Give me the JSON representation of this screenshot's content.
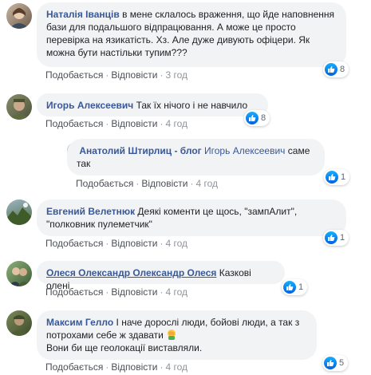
{
  "labels": {
    "like": "Подобається",
    "reply": "Відповісти",
    "dot": "·"
  },
  "comments": [
    {
      "author": "Наталія Іванців",
      "text": " в мене склалось враження, що йде наповнення бази для подальшого відпрацювання. А може це просто перевірка на язикатість. Хз. Але дуже дивують офіцери. Як можна бути настільки тупим???",
      "time": "3 год",
      "reactions": "8"
    },
    {
      "author": "Игорь Алексеевич",
      "text": " Так їх нічого і не навчило",
      "time": "4 год",
      "reactions": "8"
    },
    {
      "author": "Анатолий Штирлиц - блог",
      "text_prefix": " Игорь Алексеевич",
      "text": " саме так",
      "time": "4 год",
      "reactions": "1"
    },
    {
      "author": "Евгений Велетнюк",
      "text": " Деякі коменти це щось, \"зампАлит\", \"полковник пулеметчик\"",
      "time": "4 год",
      "reactions": "1"
    },
    {
      "author": "Олеся Олександр Олександр Олеся",
      "text": " Казкові олені",
      "time": "4 год",
      "reactions": "1"
    },
    {
      "author": "Максим Гелло",
      "text": " І наче дорослі люди, бойові люди, а так з потрохами себе ж здавати",
      "text2": "Вони би ще геолокації виставляли.",
      "time": "4 год",
      "reactions": "5"
    }
  ],
  "colors": {
    "author": "#385898",
    "bubble": "#f2f3f5",
    "like": "#0a7cff"
  },
  "icons": {
    "reaction": "like-icon",
    "emoji": "facepalm-emoji-icon"
  }
}
